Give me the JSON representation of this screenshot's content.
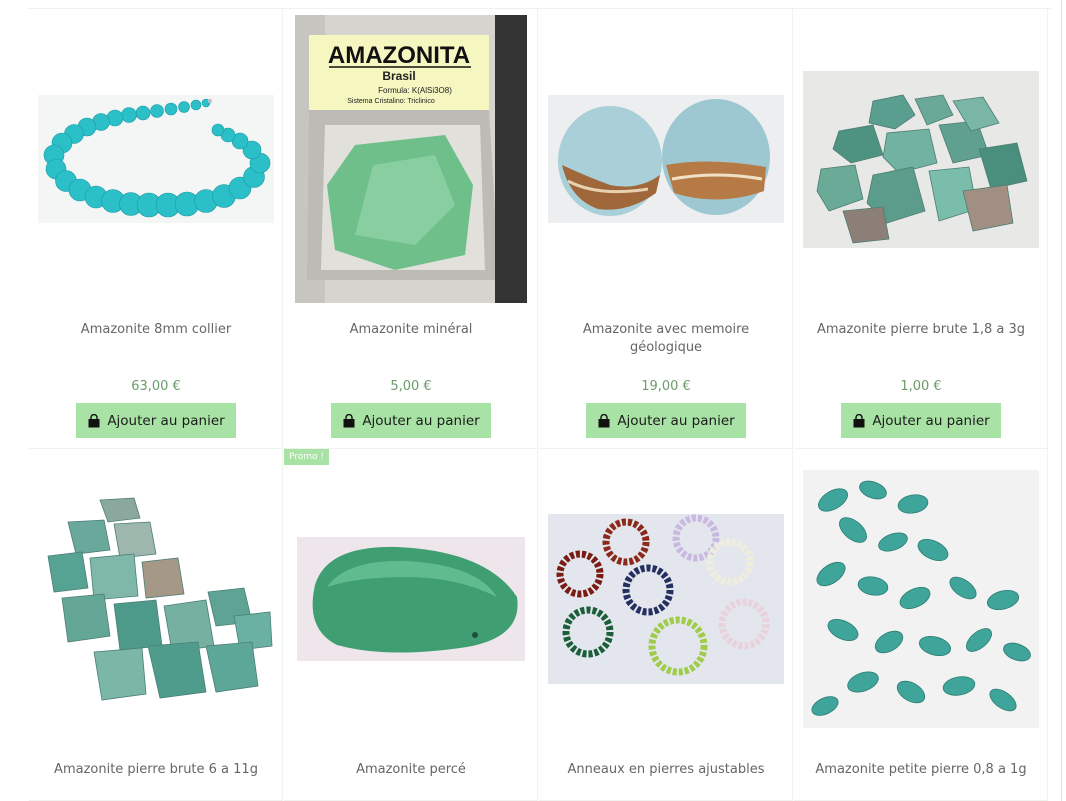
{
  "products": [
    {
      "title": "Amazonite 8mm collier",
      "price": "63,00 €",
      "button": "Ajouter au panier"
    },
    {
      "title": "Amazonite minéral",
      "price": "5,00 €",
      "button": "Ajouter au panier",
      "box_label": {
        "name": "AMAZONITA",
        "origin": "Brasil",
        "formula": "Formula: K(AlSi3O8)",
        "system": "Sistema Cristalino: Triclinico"
      }
    },
    {
      "title": "Amazonite avec memoire géologique",
      "price": "19,00 €",
      "button": "Ajouter au panier"
    },
    {
      "title": "Amazonite pierre brute 1,8 a 3g",
      "price": "1,00 €",
      "button": "Ajouter au panier"
    },
    {
      "title": "Amazonite pierre brute 6 a 11g"
    },
    {
      "title": "Amazonite percé",
      "badge": "Promo !"
    },
    {
      "title": "Anneaux en pierres ajustables"
    },
    {
      "title": "Amazonite petite pierre 0,8 a 1g"
    }
  ],
  "colors": {
    "accent": "#a8e2a4",
    "price": "#6a9c6a",
    "title": "#666666"
  },
  "icons": {
    "cart": "shopping-bag-icon"
  }
}
